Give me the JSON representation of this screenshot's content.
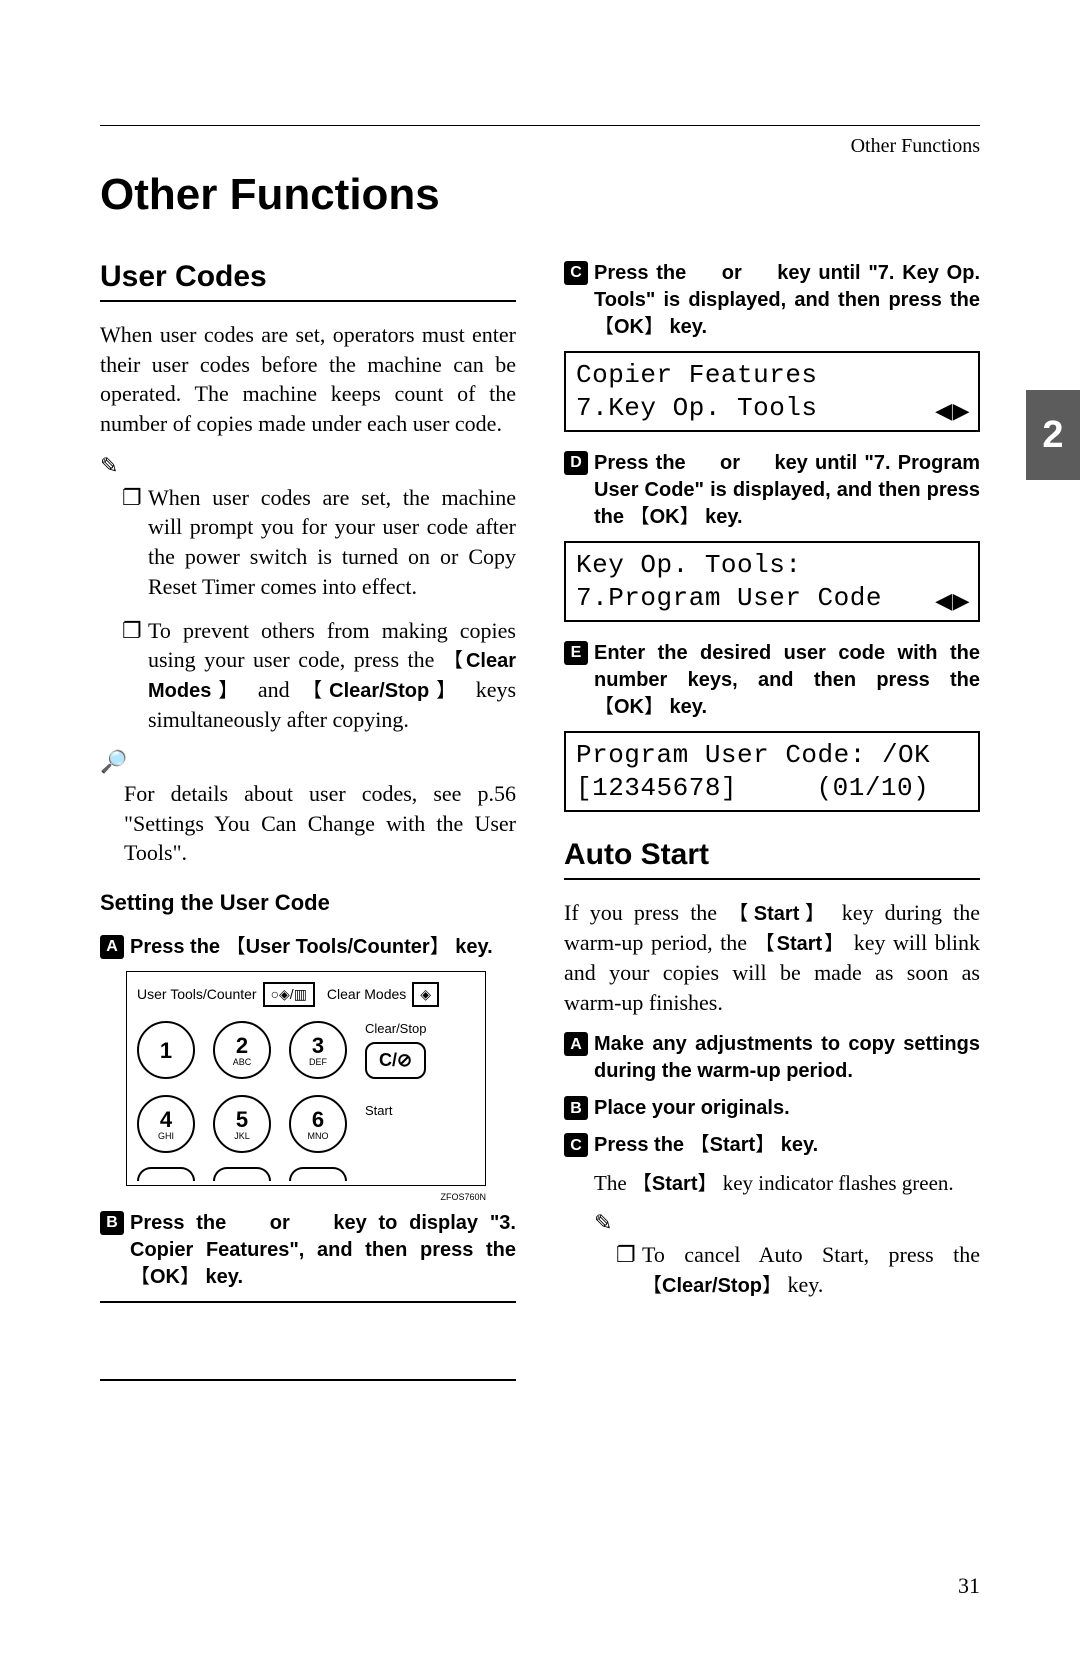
{
  "header_right": "Other Functions",
  "page_title": "Other Functions",
  "side_tab": "2",
  "page_number": "31",
  "left": {
    "h2": "User Codes",
    "intro": "When user codes are set, operators must enter their user codes before the machine can be operated. The machine keeps count of the number of copies made under each user code.",
    "bullet1": "When user codes are set, the machine will prompt you for your user code after the power switch is turned on or Copy Reset Timer comes into effect.",
    "bullet2_pre": "To prevent others from making copies using your user code, press the ",
    "bullet2_k1": "Clear Modes",
    "bullet2_mid": " and ",
    "bullet2_k2": "Clear/Stop",
    "bullet2_post": " keys simultaneously after copying.",
    "ref_note": "For details about user codes, see p.56 \"Settings You Can Change with the User Tools\".",
    "h3": "Setting the User Code",
    "stepA_pre": "Press the ",
    "stepA_key": "User Tools/Counter",
    "stepA_post": " key.",
    "keypad": {
      "ut_label": "User Tools/Counter",
      "icons1": "○◈/▥",
      "cm_label": "Clear Modes",
      "icons2": "◈",
      "keys": [
        {
          "n": "1",
          "s": ""
        },
        {
          "n": "2",
          "s": "ABC"
        },
        {
          "n": "3",
          "s": "DEF"
        },
        {
          "n": "4",
          "s": "GHI"
        },
        {
          "n": "5",
          "s": "JKL"
        },
        {
          "n": "6",
          "s": "MNO"
        }
      ],
      "clearstop": "Clear/Stop",
      "cbtn": "C/⊘",
      "start": "Start",
      "figref": "ZFOS760N"
    },
    "stepB_pre": "Press the    or    key to display \"3. Copier Features\", and then press the ",
    "stepB_key": "OK",
    "stepB_post": " key."
  },
  "right": {
    "stepC_pre": "Press the    or    key until \"7. Key Op. Tools\" is displayed, and then press the ",
    "stepC_key": "OK",
    "stepC_post": " key.",
    "lcd1_l1": "Copier Features",
    "lcd1_l2": "7.Key Op. Tools",
    "stepD_pre": "Press the    or    key until \"7. Program User Code\" is displayed, and then press the ",
    "stepD_key": "OK",
    "stepD_post": " key.",
    "lcd2_l1": "Key Op. Tools:",
    "lcd2_l2": "7.Program User Code",
    "stepE_pre": "Enter the desired user code with the number keys, and then press the ",
    "stepE_key": "OK",
    "stepE_post": " key.",
    "lcd3_l1": "Program User Code: /OK",
    "lcd3_l2": "[12345678]   (01/10)",
    "h2": "Auto Start",
    "intro_pre": "If you press the ",
    "intro_k1": "Start",
    "intro_mid1": " key during the warm-up period, the ",
    "intro_k2": "Start",
    "intro_post": " key will blink and your copies will be made as soon as warm-up finishes.",
    "as_stepA": "Make any adjustments to copy settings during the warm-up period.",
    "as_stepB": "Place your originals.",
    "as_stepC_pre": "Press the ",
    "as_stepC_key": "Start",
    "as_stepC_post": " key.",
    "as_sub_pre": "The ",
    "as_sub_key": "Start",
    "as_sub_post": " key indicator flashes green.",
    "as_note_pre": "To cancel Auto Start, press the ",
    "as_note_key": "Clear/Stop",
    "as_note_post": " key."
  }
}
